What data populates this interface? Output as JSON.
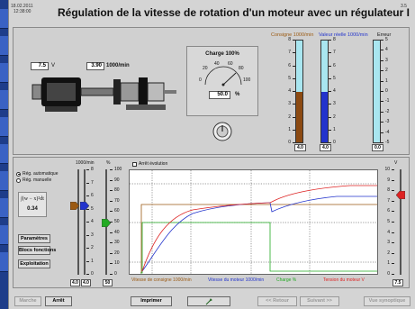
{
  "header": {
    "date": "18.02.2011",
    "time": "12:38:00",
    "title": "Régulation de la vitesse de rotation d'un moteur avec un régulateur I",
    "page": "3.5"
  },
  "top": {
    "voltage_value": "7.5",
    "voltage_unit": "V",
    "speed_value": "3.90",
    "speed_unit": "1000/min",
    "charge_title": "Charge 100%",
    "charge_value": "50.0",
    "charge_unit": "%",
    "gauge_ticks": [
      "20",
      "40",
      "60",
      "80",
      "0",
      "100"
    ],
    "bars": {
      "consigne_label": "Consigne 1000/min",
      "reelle_label": "Valeur réelle 1000/min",
      "erreur_label": "Erreur",
      "consigne_value": "4.0",
      "reelle_value": "4.0",
      "erreur_value": "0.0",
      "scale_labels": [
        "8",
        "7",
        "6",
        "5",
        "4",
        "3",
        "2",
        "1",
        "0"
      ],
      "err_scale_labels": [
        "5",
        "4",
        "3",
        "2",
        "1",
        "0",
        "-1",
        "-2",
        "-3",
        "-4",
        "-5"
      ],
      "consigne_level": 0.5,
      "reelle_level": 0.5,
      "consigne_fill": "#8c4a12",
      "reelle_fill": "#2233cc"
    }
  },
  "bottom": {
    "radio_auto": "Rég. automatique",
    "radio_manual": "Rég. manuelle",
    "formula": "∫(w − x)²dt",
    "formula_value": "0.34",
    "btn_params": "Paramètres",
    "btn_blocs": "Blocs fonctions",
    "btn_exploit": "Exploitation",
    "arret_evol": "Arrêt évolution",
    "slider_scale_label": "1000/min",
    "slider_pct_label": "%",
    "slider_v_label": "V",
    "slider_left_scale": [
      "8",
      "7",
      "6",
      "5",
      "4",
      "3",
      "2",
      "1",
      "0"
    ],
    "slider_pct_scale": [
      "100",
      "90",
      "80",
      "70",
      "60",
      "50",
      "40",
      "30",
      "20",
      "10",
      "0"
    ],
    "slider_right_scale": [
      "10",
      "9",
      "8",
      "7",
      "6",
      "5",
      "4",
      "3",
      "2",
      "1",
      "0"
    ],
    "val_w": "4.0",
    "val_x": "4.0",
    "val_charge": "50",
    "val_u": "7.5",
    "legend_consigne": "Vitesse de consigne 1000/min",
    "legend_moteur": "Vitesse du moteur 1000/min",
    "legend_charge": "Charge %",
    "legend_tension": "Tension du moteur V",
    "colors": {
      "consigne": "#9b5a12",
      "moteur": "#2233cc",
      "charge": "#22aa22",
      "tension": "#dd2222"
    }
  },
  "footer": {
    "marche": "Marche",
    "arret": "Arrêt",
    "imprimer": "Imprimer",
    "retour": "<< Retour",
    "suivant": "Suivant >>",
    "vue": "Vue synoptique"
  }
}
